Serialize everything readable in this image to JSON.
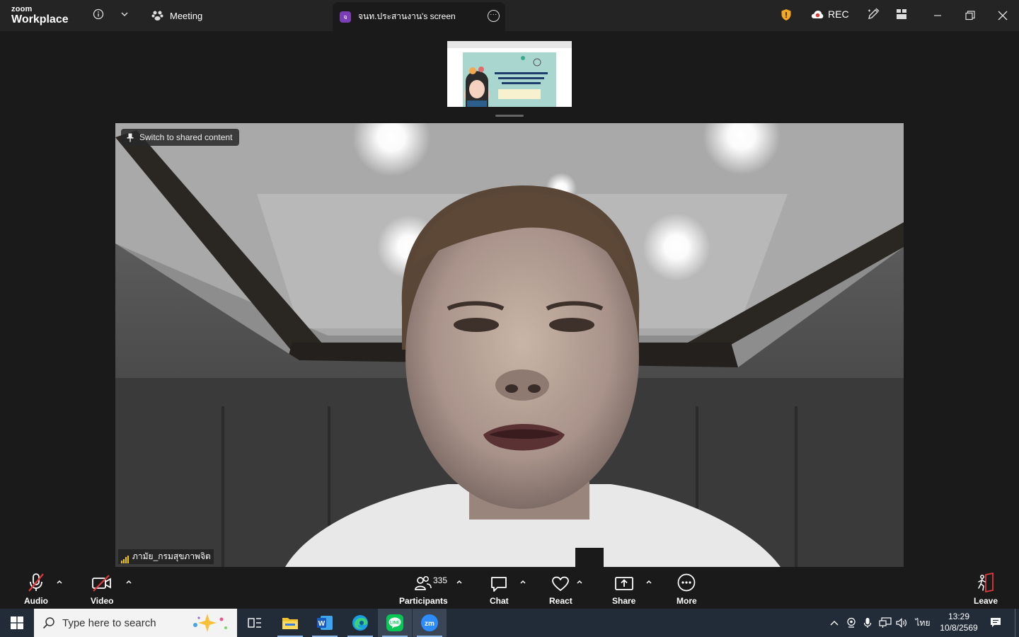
{
  "app": {
    "brand_small": "zoom",
    "brand_big": "Workplace"
  },
  "titlebar": {
    "meeting_tab_label": "Meeting",
    "share_tab_badge": "จ",
    "share_tab_label": "จนท.ประสานงาน's screen",
    "rec_label": "REC"
  },
  "stage": {
    "switch_label": "Switch to shared content",
    "participant_name": "ภามัย_กรมสุขภาพจิต"
  },
  "toolbar": {
    "audio_label": "Audio",
    "video_label": "Video",
    "participants_label": "Participants",
    "participants_count": "335",
    "chat_label": "Chat",
    "react_label": "React",
    "share_label": "Share",
    "more_label": "More",
    "leave_label": "Leave"
  },
  "taskbar": {
    "search_placeholder": "Type here to search",
    "lang": "ไทย",
    "time": "13:29",
    "date": "10/8/2569"
  },
  "colors": {
    "accent_purple": "#7b3fb5",
    "shield": "#f5a623",
    "rec_red": "#e0393e",
    "leave_red": "#e0393e"
  }
}
